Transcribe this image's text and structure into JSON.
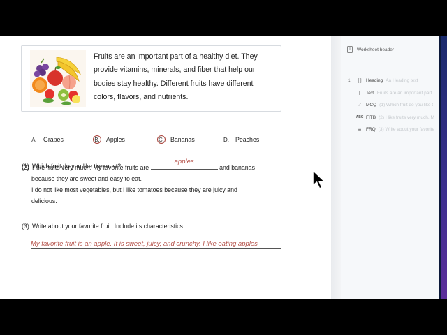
{
  "intro": {
    "text": "Fruits are an important part of a healthy diet. They provide vitamins, minerals, and fiber that help our bodies stay healthy. Different fruits have different colors, flavors, and nutrients."
  },
  "q1": {
    "number": "(1)",
    "question": "Which fruit do you like the most?",
    "options": [
      {
        "letter": "A.",
        "label": "Grapes"
      },
      {
        "letter": "B.",
        "label": "Apples"
      },
      {
        "letter": "C.",
        "label": "Bananas"
      },
      {
        "letter": "D.",
        "label": "Peaches"
      }
    ]
  },
  "q2": {
    "number": "(2)",
    "before_blank": "I like fruits very much. My favorite fruits are",
    "blank_answer": "apples",
    "after_blank": "and bananas",
    "line2": "because they are sweet and easy to eat.",
    "line3": "I do not like most vegetables, but I like tomatoes because they are juicy and",
    "line4": "delicious."
  },
  "q3": {
    "number": "(3)",
    "question": "Write about your favorite fruit. Include its characteristics.",
    "answer": "My favorite fruit is an apple. It is sweet, juicy, and crunchy. I like eating apples"
  },
  "panel": {
    "header": "Worksheet header",
    "dots": "...",
    "outline": [
      {
        "num": "1",
        "icon": "heading-icon",
        "glyph": "[ ]",
        "label": "Heading",
        "snippet": "Aa Heading text"
      },
      {
        "num": "",
        "icon": "text-icon",
        "glyph": "T",
        "label": "Text",
        "snippet": "Fruits are an important part"
      },
      {
        "num": "",
        "icon": "mcq-icon",
        "glyph": "✓",
        "label": "MCQ",
        "snippet": "(1) Which fruit do you like t"
      },
      {
        "num": "",
        "icon": "fitb-icon",
        "glyph": "ABC",
        "label": "FITB",
        "snippet": "(2) I like fruits very much. M"
      },
      {
        "num": "",
        "icon": "frq-icon",
        "glyph": "≡",
        "label": "FRQ",
        "snippet": "(3) Write about your favorite"
      }
    ]
  },
  "colors": {
    "accent_red": "#b5524a",
    "panel_bg": "#f6f8fa"
  }
}
